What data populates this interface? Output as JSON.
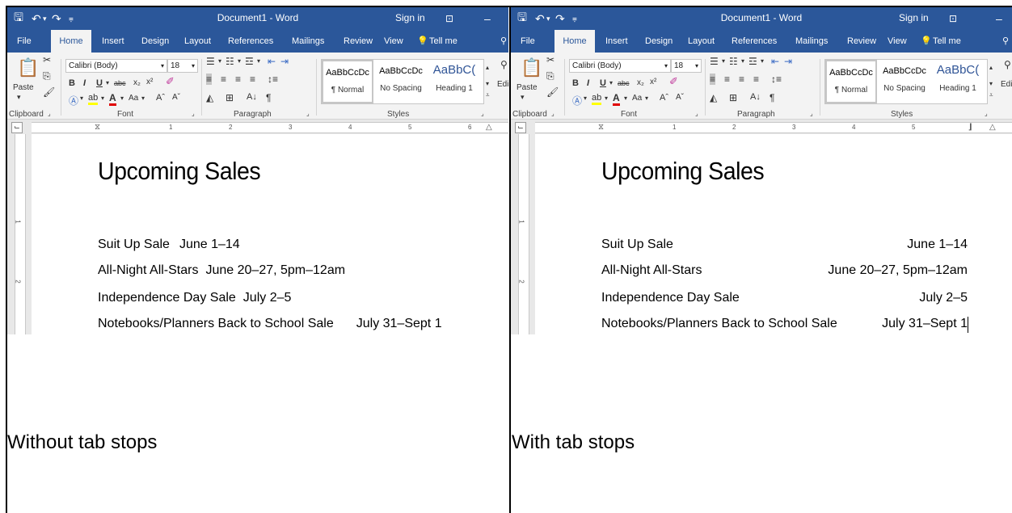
{
  "app": {
    "window_title": "Document1 - Word",
    "sign_in": "Sign in",
    "tabs": [
      "File",
      "Home",
      "Insert",
      "Design",
      "Layout",
      "References",
      "Mailings",
      "Review",
      "View"
    ],
    "tell_me": "Tell me",
    "font_name": "Calibri (Body)",
    "font_size": "18",
    "paste_label": "Paste",
    "group_labels": [
      "Clipboard",
      "Font",
      "Paragraph",
      "Styles"
    ],
    "editing_label": "Editi",
    "styles": [
      {
        "sample": "AaBbCcDc",
        "name": "¶ Normal"
      },
      {
        "sample": "AaBbCcDc",
        "name": "No Spacing"
      },
      {
        "sample": "AaBbC(",
        "name": "Heading 1"
      }
    ],
    "ruler_numbers": [
      "1",
      "2",
      "3",
      "4",
      "5",
      "6"
    ],
    "vruler_numbers": [
      "1",
      "2"
    ]
  },
  "doc": {
    "title": "Upcoming Sales",
    "rows": [
      {
        "name": "Suit Up Sale",
        "date": "June 1–14"
      },
      {
        "name": "All-Night All-Stars",
        "date": "June 20–27, 5pm–12am"
      },
      {
        "name": "Independence Day Sale",
        "date": "July 2–5"
      },
      {
        "name": "Notebooks/Planners Back to School Sale",
        "date": "July 31–Sept 1"
      }
    ]
  },
  "captions": {
    "left": "Without tab stops",
    "right": "With tab stops"
  },
  "colors": {
    "word_blue": "#2b579a",
    "ribbon_bg": "#f3f3f3"
  }
}
